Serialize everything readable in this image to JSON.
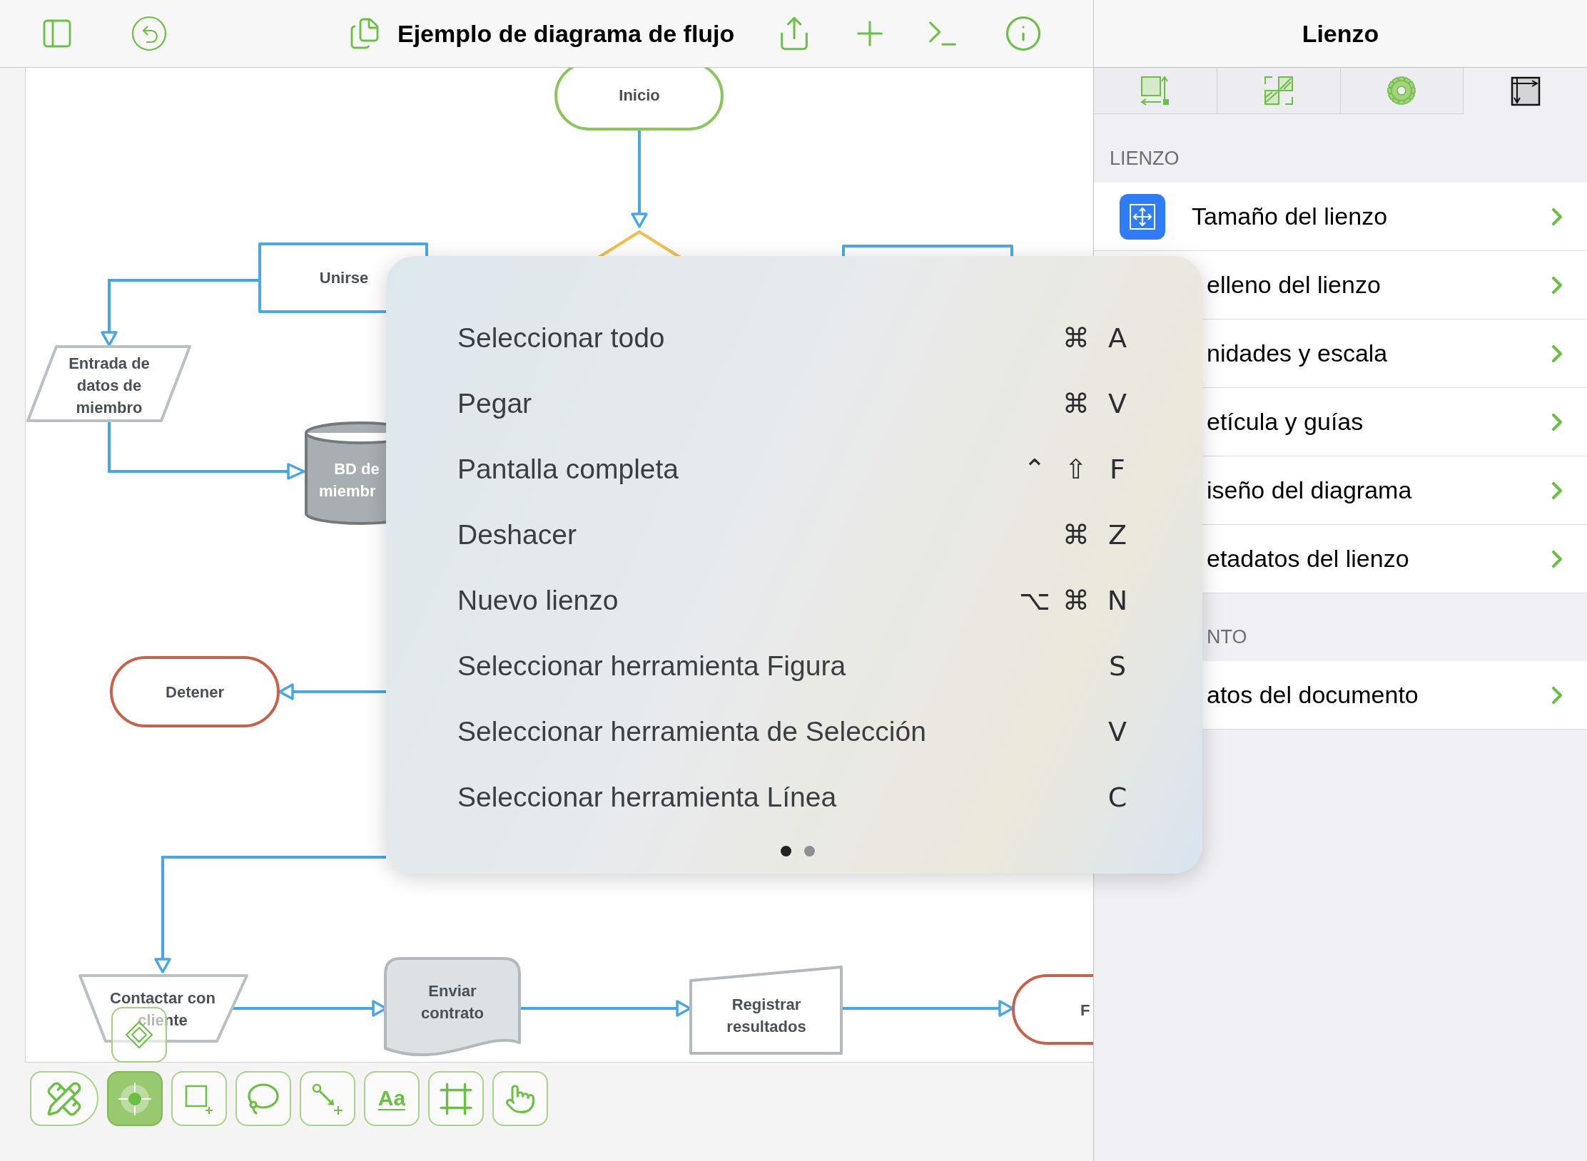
{
  "toolbar": {
    "title": "Ejemplo de diagrama de flujo"
  },
  "canvas": {
    "nodes": [
      {
        "kind": "terminator",
        "color": "#8cc65a",
        "lines": [
          "Inicio"
        ]
      },
      {
        "kind": "decision",
        "color": "#f2bd4b"
      },
      {
        "kind": "process",
        "color": "#4aa8e6",
        "lines": [
          "Unirse"
        ]
      },
      {
        "kind": "process",
        "color": "#4aa8e6"
      },
      {
        "kind": "data",
        "color": "#b9bfc3",
        "lines": [
          "Entrada de",
          "datos de",
          "miembro"
        ]
      },
      {
        "kind": "database",
        "color": "#76797c",
        "lines": [
          "BD de",
          "miembr"
        ]
      },
      {
        "kind": "terminator",
        "color": "#c8604a",
        "lines": [
          "Detener"
        ]
      },
      {
        "kind": "manual-operation",
        "color": "#b9bfc3",
        "lines": [
          "Contactar con",
          "cliente"
        ]
      },
      {
        "kind": "document",
        "color": "#b3b8bc",
        "lines": [
          "Enviar",
          "contrato"
        ]
      },
      {
        "kind": "manual-input",
        "color": "#b3b8bc",
        "lines": [
          "Registrar",
          "resultados"
        ]
      },
      {
        "kind": "terminator",
        "color": "#c8604a",
        "lines": [
          "F"
        ]
      }
    ]
  },
  "tools": [
    {
      "kind": "pencil",
      "selected": false
    },
    {
      "kind": "target",
      "selected": true
    },
    {
      "kind": "shape",
      "selected": false
    },
    {
      "kind": "lasso",
      "selected": false
    },
    {
      "kind": "connector",
      "selected": false
    },
    {
      "kind": "text",
      "selected": false,
      "text": "Aa"
    },
    {
      "kind": "frame",
      "selected": false
    },
    {
      "kind": "hand",
      "selected": false
    }
  ],
  "inspector": {
    "title": "Lienzo",
    "tabs": [
      {
        "kind": "size",
        "selected": false
      },
      {
        "kind": "fill",
        "selected": false
      },
      {
        "kind": "gear",
        "selected": false
      },
      {
        "kind": "grid",
        "selected": true
      }
    ],
    "sections": [
      {
        "header": "LIENZO",
        "rows": [
          {
            "kind": "with-icon",
            "label": "Tamaño del lienzo"
          },
          {
            "kind": "clipped",
            "label": "elleno del lienzo"
          },
          {
            "kind": "clipped",
            "label": "nidades y escala"
          },
          {
            "kind": "clipped",
            "label": "etícula y guías"
          },
          {
            "kind": "clipped",
            "label": "iseño del diagrama"
          },
          {
            "kind": "clipped",
            "label": "etadatos del lienzo"
          }
        ]
      },
      {
        "header": "NTO",
        "rows": [
          {
            "kind": "clipped",
            "label": "atos del documento"
          }
        ]
      }
    ]
  },
  "shortcuts_popup": {
    "items": [
      {
        "label": "Seleccionar todo",
        "keys": [
          "⌘",
          "A"
        ]
      },
      {
        "label": "Pegar",
        "keys": [
          "⌘",
          "V"
        ]
      },
      {
        "label": "Pantalla completa",
        "keys": [
          "⌃",
          "⇧",
          "F"
        ]
      },
      {
        "label": "Deshacer",
        "keys": [
          "⌘",
          "Z"
        ]
      },
      {
        "label": "Nuevo lienzo",
        "keys": [
          "⌥",
          "⌘",
          "N"
        ]
      },
      {
        "label": "Seleccionar herramienta Figura",
        "keys": [
          "S"
        ]
      },
      {
        "label": "Seleccionar herramienta de Selección",
        "keys": [
          "V"
        ]
      },
      {
        "label": "Seleccionar herramienta Línea",
        "keys": [
          "C"
        ]
      }
    ],
    "pages": [
      {
        "selected": true
      },
      {
        "selected": false
      }
    ]
  }
}
